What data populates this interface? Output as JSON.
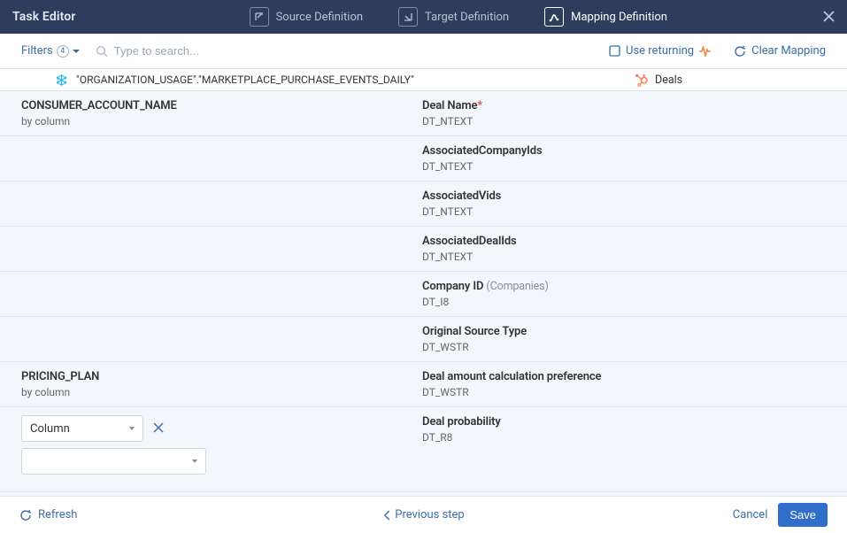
{
  "header": {
    "title": "Task Editor",
    "tabs": [
      {
        "label": "Source Definition"
      },
      {
        "label": "Target Definition"
      },
      {
        "label": "Mapping Definition"
      }
    ],
    "active_tab_index": 2
  },
  "toolbar": {
    "filters_label": "Filters",
    "filters_count": "4",
    "search_placeholder": "Type to search...",
    "use_returning_label": "Use returning",
    "clear_mapping_label": "Clear Mapping"
  },
  "breadcrumb": {
    "source_path": "\"ORGANIZATION_USAGE\".\"MARKETPLACE_PURCHASE_EVENTS_DAILY\"",
    "target_path": "Deals"
  },
  "rows": [
    {
      "left": {
        "name": "CONSUMER_ACCOUNT_NAME",
        "sub": "by column"
      },
      "right": {
        "name": "Deal Name",
        "required": true,
        "sub": "DT_NTEXT"
      }
    },
    {
      "left": null,
      "right": {
        "name": "AssociatedCompanyIds",
        "sub": "DT_NTEXT"
      }
    },
    {
      "left": null,
      "right": {
        "name": "AssociatedVids",
        "sub": "DT_NTEXT"
      }
    },
    {
      "left": null,
      "right": {
        "name": "AssociatedDealIds",
        "sub": "DT_NTEXT"
      }
    },
    {
      "left": null,
      "right": {
        "name": "Company ID",
        "paren": "(Companies)",
        "sub": "DT_I8"
      }
    },
    {
      "left": null,
      "right": {
        "name": "Original Source Type",
        "sub": "DT_WSTR"
      }
    },
    {
      "left": {
        "name": "PRICING_PLAN",
        "sub": "by column"
      },
      "right": {
        "name": "Deal amount calculation preference",
        "sub": "DT_WSTR"
      }
    }
  ],
  "editor": {
    "dropdown_value": "Column",
    "second_dropdown_value": "",
    "right": {
      "name": "Deal probability",
      "sub": "DT_R8"
    }
  },
  "footer": {
    "refresh_label": "Refresh",
    "previous_label": "Previous step",
    "cancel_label": "Cancel",
    "save_label": "Save"
  }
}
